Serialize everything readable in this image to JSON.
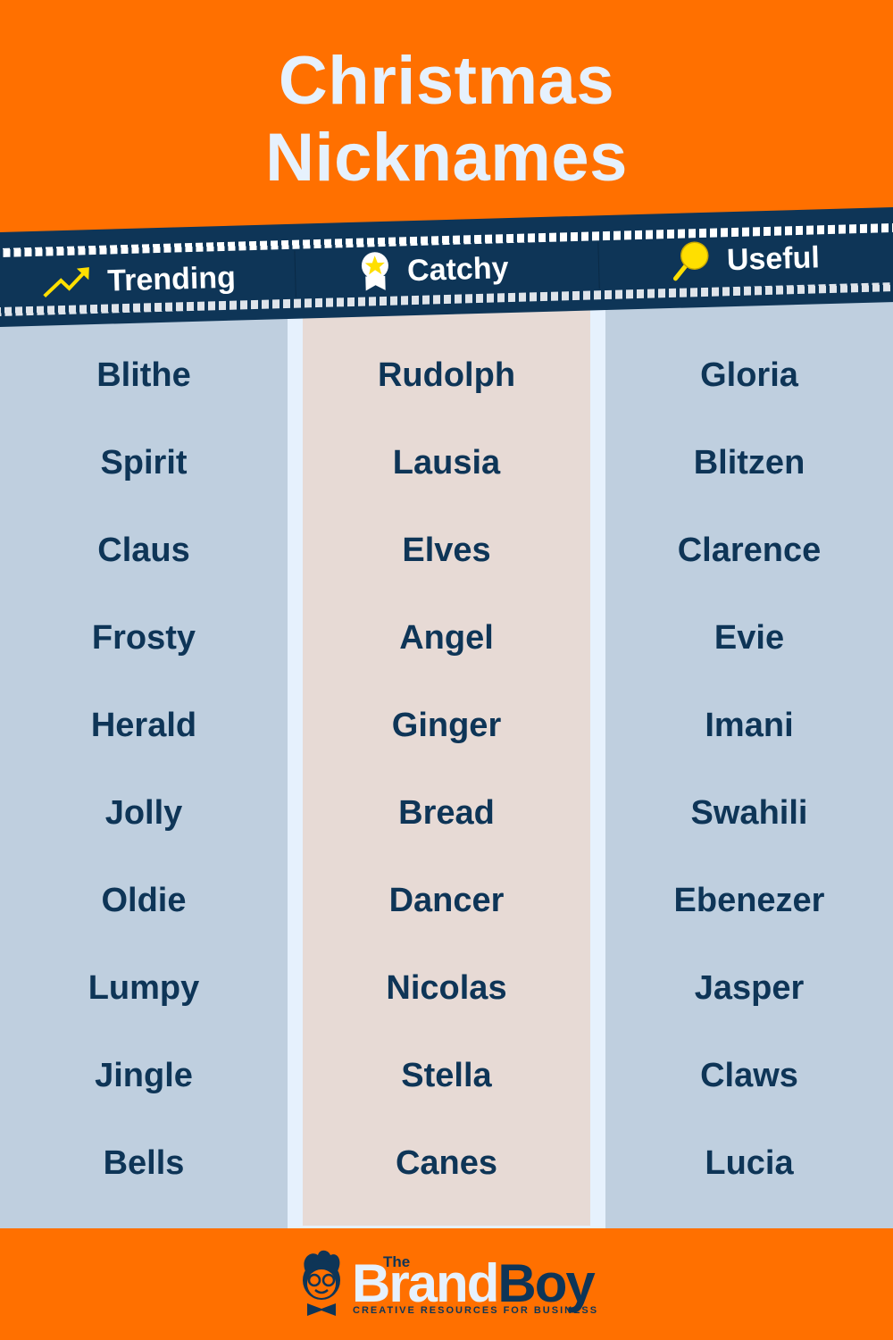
{
  "title": {
    "line1": "Christmas",
    "line2": "Nicknames"
  },
  "categories": [
    {
      "label": "Trending",
      "icon": "trending-up-icon"
    },
    {
      "label": "Catchy",
      "icon": "award-badge-icon"
    },
    {
      "label": "Useful",
      "icon": "magnifier-icon"
    }
  ],
  "columns": {
    "trending": [
      "Blithe",
      "Spirit",
      "Claus",
      "Frosty",
      "Herald",
      "Jolly",
      "Oldie",
      "Lumpy",
      "Jingle",
      "Bells"
    ],
    "catchy": [
      "Rudolph",
      "Lausia",
      "Elves",
      "Angel",
      "Ginger",
      "Bread",
      "Dancer",
      "Nicolas",
      "Stella",
      "Canes"
    ],
    "useful": [
      "Gloria",
      "Blitzen",
      "Clarence",
      "Evie",
      "Imani",
      "Swahili",
      "Ebenezer",
      "Jasper",
      "Claws",
      "Lucia"
    ]
  },
  "footer": {
    "logo_the": "The",
    "logo_brand": "Brand",
    "logo_boy": "Boy",
    "tagline": "CREATIVE RESOURCES FOR BUSINESS"
  },
  "colors": {
    "orange": "#ff7000",
    "navy": "#0e3557",
    "column_blue": "#bfcfdf",
    "column_beige": "#e7dad5",
    "icon_yellow": "#ffdf00"
  }
}
